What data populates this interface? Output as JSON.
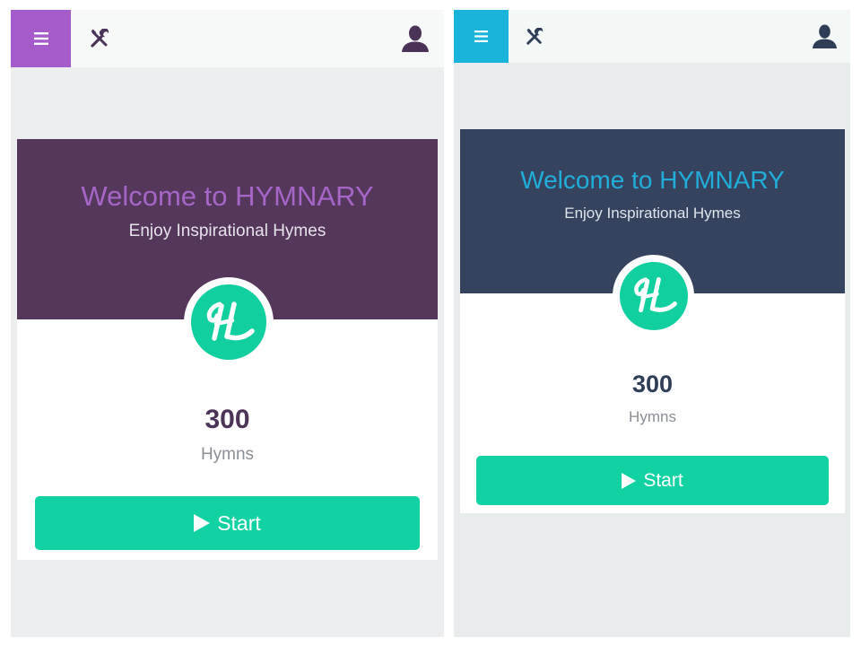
{
  "screens": [
    {
      "id": "purple",
      "colors": {
        "accent": "#a65bca",
        "hero": "#55375c",
        "welcome": "#a566c8",
        "icon": "#4a3356"
      },
      "menu_icon": "hamburger-icon",
      "tools_icon": "tools-icon",
      "user_icon": "user-icon",
      "welcome_title": "Welcome to HYMNARY",
      "tagline": "Enjoy Inspirational Hymes",
      "logo_icon": "hymnary-logo",
      "hymn_count": "300",
      "hymn_label": "Hymns",
      "start_label": "Start",
      "start_icon": "play-icon"
    },
    {
      "id": "blue",
      "colors": {
        "accent": "#1ab4db",
        "hero": "#35435f",
        "welcome": "#21aedb",
        "icon": "#2f3d57"
      },
      "menu_icon": "hamburger-icon",
      "tools_icon": "tools-icon",
      "user_icon": "user-icon",
      "welcome_title": "Welcome to HYMNARY",
      "tagline": "Enjoy Inspirational Hymes",
      "logo_icon": "hymnary-logo",
      "hymn_count": "300",
      "hymn_label": "Hymns",
      "start_label": "Start",
      "start_icon": "play-icon"
    }
  ]
}
